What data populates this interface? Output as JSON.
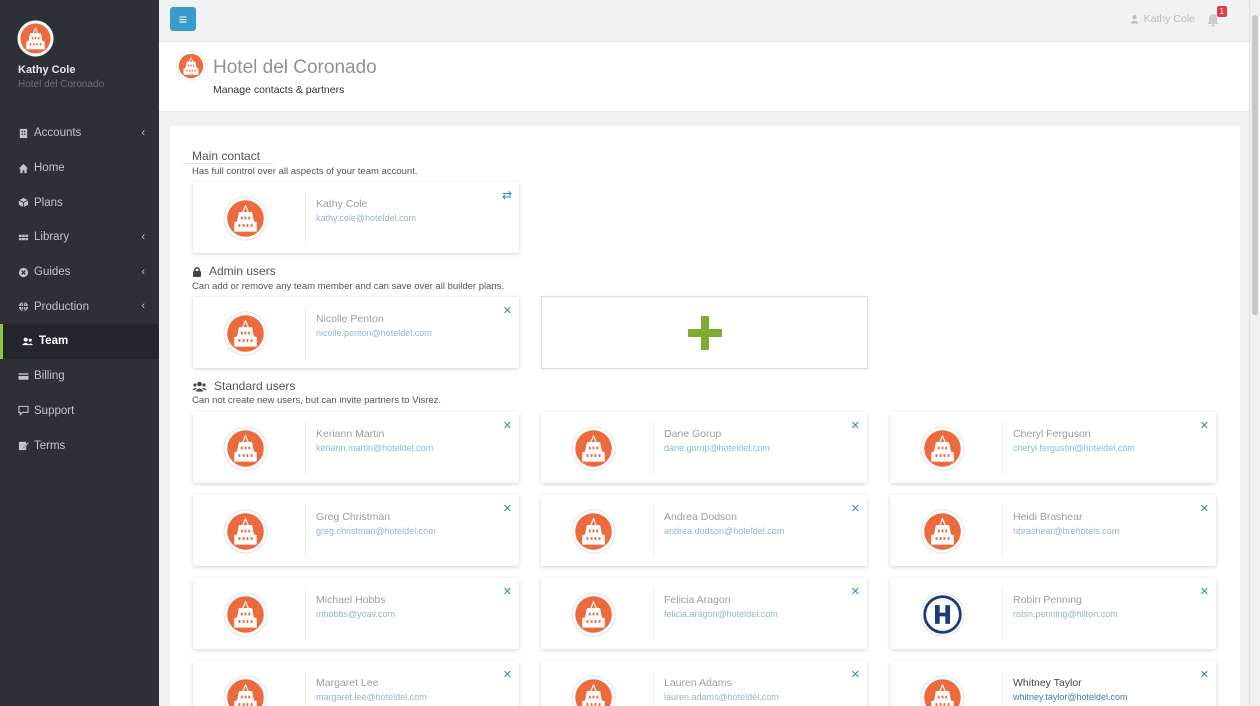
{
  "sidebar": {
    "user_name": "Kathy Cole",
    "hotel_name": "Hotel del Coronado",
    "items": [
      {
        "label": "Accounts",
        "icon": "building-icon",
        "has_chevron": true
      },
      {
        "label": "Home",
        "icon": "home-icon",
        "has_chevron": false
      },
      {
        "label": "Plans",
        "icon": "cube-icon",
        "has_chevron": false
      },
      {
        "label": "Library",
        "icon": "grid-icon",
        "has_chevron": true
      },
      {
        "label": "Guides",
        "icon": "compass-icon",
        "has_chevron": true
      },
      {
        "label": "Production",
        "icon": "globe-icon",
        "has_chevron": true
      },
      {
        "label": "Team",
        "icon": "users-icon",
        "has_chevron": false,
        "active": true
      },
      {
        "label": "Billing",
        "icon": "credit-card-icon",
        "has_chevron": false
      },
      {
        "label": "Support",
        "icon": "chat-icon",
        "has_chevron": false
      },
      {
        "label": "Terms",
        "icon": "edit-icon",
        "has_chevron": false
      }
    ]
  },
  "topbar": {
    "user_name": "Kathy Cole",
    "notification_count": "1"
  },
  "header": {
    "title": "Hotel del Coronado",
    "subtitle": "Manage contacts & partners"
  },
  "sections": {
    "main_contact": {
      "title": "Main contact",
      "description": "Has full control over all aspects of your team account.",
      "card": {
        "name": "Kathy Cole",
        "email": "kathy.cole@hoteldel.com"
      }
    },
    "admin_users": {
      "title": "Admin users",
      "description": "Can add or remove any team member and can save over all builder plans.",
      "cards": [
        {
          "name": "Nicolle Penton",
          "email": "nicolle.penton@hoteldel.com"
        }
      ]
    },
    "standard_users": {
      "title": "Standard users",
      "description": "Can not create new users, but can invite partners to Visrez.",
      "cards": [
        {
          "name": "Keriann Martin",
          "email": "keriann.martin@hoteldel.com",
          "logo": "coronado"
        },
        {
          "name": "Dane Gorup",
          "email": "dane.gorup@hoteldel.com",
          "logo": "coronado"
        },
        {
          "name": "Cheryl Ferguson",
          "email": "cheryl.ferguson@hoteldel.com",
          "logo": "coronado"
        },
        {
          "name": "Greg Christman",
          "email": "greg.christman@hoteldel.com",
          "logo": "coronado"
        },
        {
          "name": "Andrea Dodson",
          "email": "andrea.dodson@hoteldel.com",
          "logo": "coronado"
        },
        {
          "name": "Heidi Brashear",
          "email": "hbrashear@brehotels.com",
          "logo": "coronado"
        },
        {
          "name": "Michael Hobbs",
          "email": "mhobbs@yoav.com",
          "logo": "coronado"
        },
        {
          "name": "Felicia Aragon",
          "email": "felicia.aragon@hoteldel.com",
          "logo": "coronado"
        },
        {
          "name": "Robin Penning",
          "email": "robin.penning@hilton.com",
          "logo": "hilton"
        },
        {
          "name": "Margaret Lee",
          "email": "margaret.lee@hoteldel.com",
          "logo": "coronado"
        },
        {
          "name": "Lauren Adams",
          "email": "lauren.adams@hoteldel.com",
          "logo": "coronado"
        },
        {
          "name": "Whitney Taylor",
          "email": "whitney.taylor@hoteldel.com",
          "logo": "coronado"
        }
      ]
    }
  },
  "colors": {
    "sidebar_bg": "#2d3035",
    "accent_green": "#8cc63f",
    "accent_blue": "#3a9ccc",
    "logo_orange": "#ec6a3c"
  }
}
